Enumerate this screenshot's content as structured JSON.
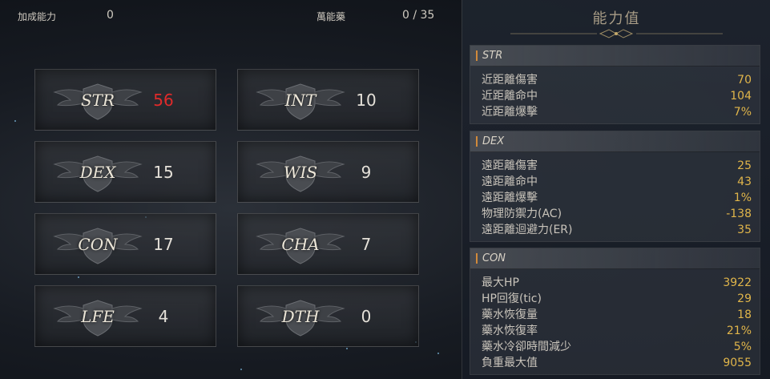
{
  "header": {
    "bonus_label": "加成能力",
    "bonus_value": "0",
    "elixir_label": "萬能藥",
    "elixir_value": "0 / 35"
  },
  "stats": [
    {
      "name": "STR",
      "value": "56",
      "highlight": true
    },
    {
      "name": "INT",
      "value": "10",
      "highlight": false
    },
    {
      "name": "DEX",
      "value": "15",
      "highlight": false
    },
    {
      "name": "WIS",
      "value": "9",
      "highlight": false
    },
    {
      "name": "CON",
      "value": "17",
      "highlight": false
    },
    {
      "name": "CHA",
      "value": "7",
      "highlight": false
    },
    {
      "name": "LFE",
      "value": "4",
      "highlight": false
    },
    {
      "name": "DTH",
      "value": "0",
      "highlight": false
    }
  ],
  "panel": {
    "title": "能力值",
    "sections": [
      {
        "title": "STR",
        "rows": [
          {
            "label": "近距離傷害",
            "value": "70"
          },
          {
            "label": "近距離命中",
            "value": "104"
          },
          {
            "label": "近距離爆擊",
            "value": "7%"
          }
        ]
      },
      {
        "title": "DEX",
        "rows": [
          {
            "label": "遠距離傷害",
            "value": "25"
          },
          {
            "label": "遠距離命中",
            "value": "43"
          },
          {
            "label": "遠距離爆擊",
            "value": "1%"
          },
          {
            "label": "物理防禦力(AC)",
            "value": "-138"
          },
          {
            "label": "遠距離迴避力(ER)",
            "value": "35"
          }
        ]
      },
      {
        "title": "CON",
        "rows": [
          {
            "label": "最大HP",
            "value": "3922"
          },
          {
            "label": "HP回復(tic)",
            "value": "29"
          },
          {
            "label": "藥水恢復量",
            "value": "18"
          },
          {
            "label": "藥水恢復率",
            "value": "21%"
          },
          {
            "label": "藥水冷卻時間減少",
            "value": "5%"
          },
          {
            "label": "負重最大值",
            "value": "9055"
          }
        ]
      }
    ]
  },
  "colors": {
    "highlight_value": "#e02a2a",
    "stat_value_gold": "#e0b54a",
    "section_accent": "#d18a3a"
  },
  "icons": {
    "stat_emblem": "winged-shield-icon",
    "title_ornament": "ornament-divider-icon"
  }
}
